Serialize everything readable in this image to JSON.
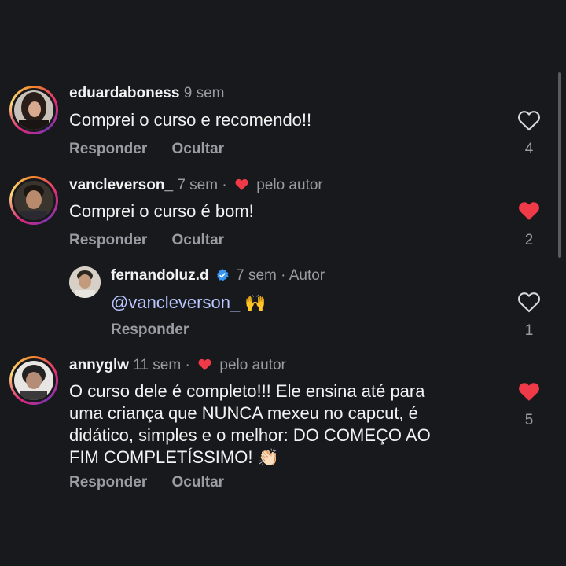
{
  "comments": [
    {
      "username": "eduardaboness",
      "time": "9 sem",
      "text": "Comprei o curso e recomendo!!",
      "reply_label": "Responder",
      "hide_label": "Ocultar",
      "likes": "4",
      "liked": false
    },
    {
      "username": "vancleverson_",
      "time": "7 sem ·",
      "liked_by_author": "pelo autor",
      "text": "Comprei o curso é bom!",
      "reply_label": "Responder",
      "hide_label": "Ocultar",
      "likes": "2",
      "liked": true
    },
    {
      "username": "fernandoluz.d",
      "time": "7 sem · Autor",
      "mention": "@vancleverson_",
      "emoji": "🙌",
      "reply_label": "Responder",
      "likes": "1",
      "liked": false,
      "verified": true
    },
    {
      "username": "annyglw",
      "time": "11 sem ·",
      "liked_by_author": "pelo autor",
      "text_lines": [
        "O curso dele é completo!!! Ele ensina até para",
        "uma criança que NUNCA mexeu no capcut, é",
        "didático, simples e o melhor: DO COMEÇO AO",
        "FIM COMPLETÍSSIMO!"
      ],
      "emoji": "👏🏻",
      "reply_label": "Responder",
      "hide_label": "Ocultar",
      "likes": "5",
      "liked": true
    }
  ],
  "colors": {
    "background": "#18191d",
    "like_red": "#f03a47",
    "muted": "#9a9ca3",
    "mention": "#b9c6ff",
    "verified_blue": "#3897f0"
  }
}
